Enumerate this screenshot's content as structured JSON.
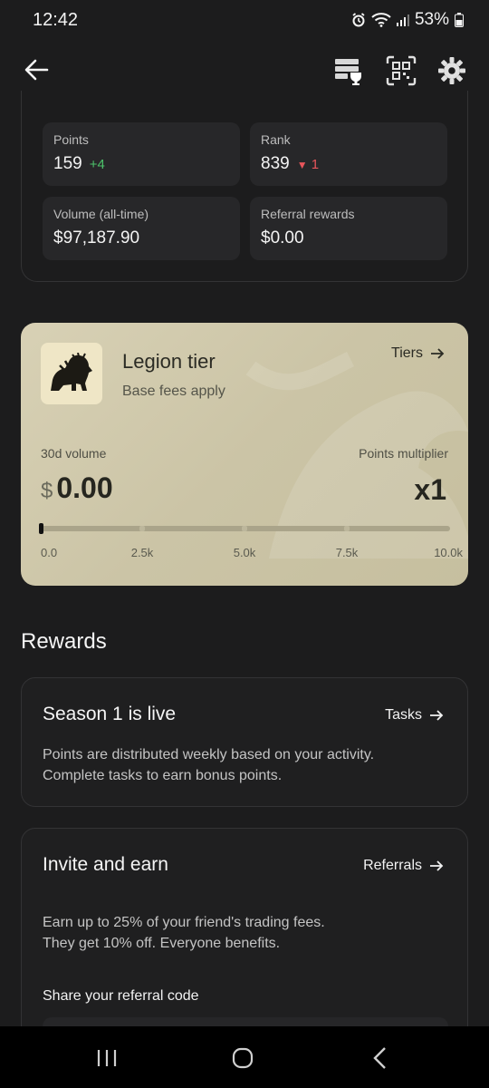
{
  "status_bar": {
    "time": "12:42",
    "battery": "53%",
    "icons": [
      "alarm-icon",
      "wifi-icon",
      "signal-icon",
      "battery-icon"
    ]
  },
  "header": {
    "back_icon": "arrow-left-icon",
    "actions": [
      "leaderboard-trophy-icon",
      "qr-scan-icon",
      "gear-icon"
    ]
  },
  "stats": {
    "points": {
      "label": "Points",
      "value": "159",
      "delta": "+4"
    },
    "rank": {
      "label": "Rank",
      "value": "839",
      "delta_symbol": "▼",
      "delta": "1"
    },
    "volume": {
      "label": "Volume (all-time)",
      "value": "$97,187.90"
    },
    "referral": {
      "label": "Referral rewards",
      "value": "$0.00"
    }
  },
  "tier": {
    "name": "Legion tier",
    "subtitle": "Base fees apply",
    "link_label": "Tiers",
    "volume_label": "30d volume",
    "volume_currency": "$",
    "volume_value": "0.00",
    "multiplier_label": "Points multiplier",
    "multiplier_value": "x1",
    "progress_fraction": 0,
    "scale_labels": [
      "0.0",
      "2.5k",
      "5.0k",
      "7.5k",
      "10.0k"
    ]
  },
  "rewards": {
    "heading": "Rewards",
    "season": {
      "title": "Season 1 is live",
      "link_label": "Tasks",
      "body_line1": "Points are distributed weekly based on your activity.",
      "body_line2": "Complete tasks to earn bonus points."
    },
    "invite": {
      "title": "Invite and earn",
      "link_label": "Referrals",
      "body_line1": "Earn up to 25% of your friend's trading fees.",
      "body_line2": "They get 10% off. Everyone benefits.",
      "share_label": "Share your referral code"
    }
  },
  "colors": {
    "background": "#1c1c1d",
    "tier_card": "#d0c9ad",
    "positive": "#4cc26a",
    "negative": "#e8555b"
  }
}
